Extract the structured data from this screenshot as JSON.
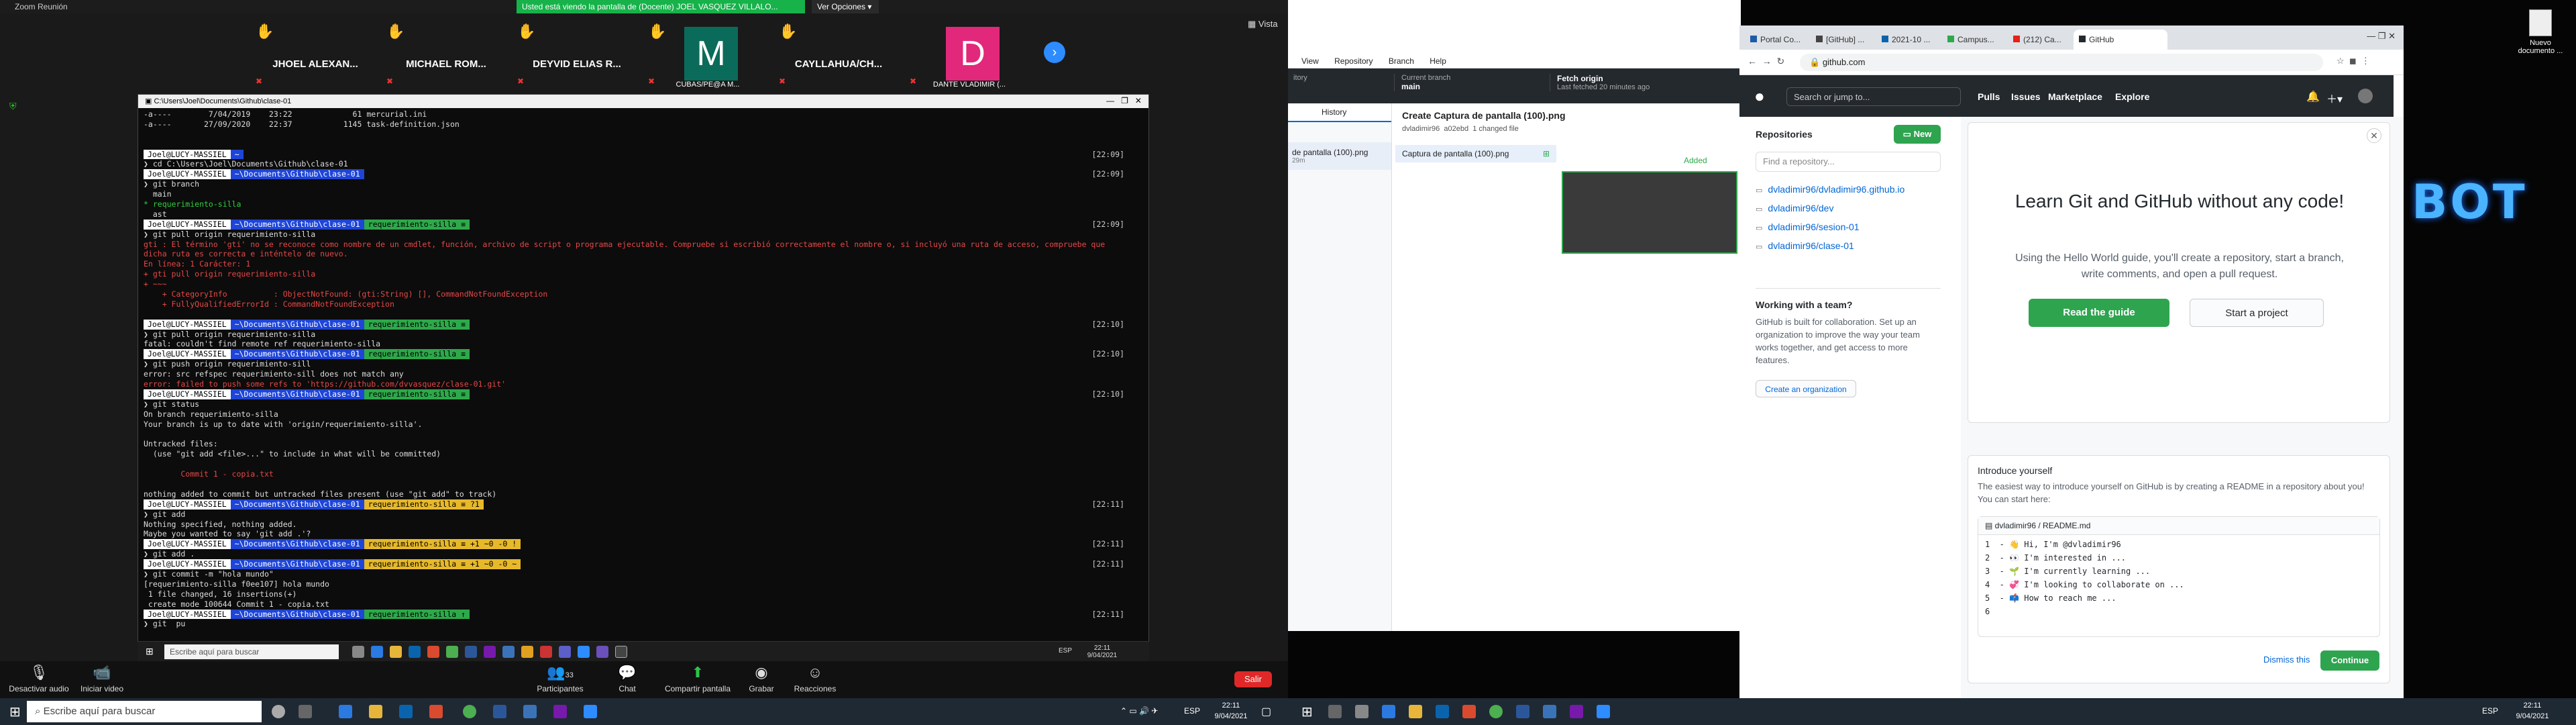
{
  "zoom": {
    "title": "Zoom Reunión",
    "banner": "Usted está viendo la pantalla de (Docente) JOEL VASQUEZ VILLALO...",
    "view_options": "Ver Opciones ▾",
    "vista": "Vista",
    "participants": [
      {
        "name": "JHOEL ALEXAN...",
        "hand": true,
        "avatar": "",
        "color": ""
      },
      {
        "name": "MICHAEL ROM...",
        "hand": true,
        "avatar": "",
        "color": ""
      },
      {
        "name": "DEYVID ELIAS R...",
        "hand": true,
        "avatar": "",
        "color": ""
      },
      {
        "name": "CUBAS/PE@A M...",
        "hand": true,
        "avatar": "M",
        "color": "#0b6b5a"
      },
      {
        "name": "CAYLLAHUA/CH...",
        "hand": true,
        "avatar": "",
        "color": ""
      },
      {
        "name": "DANTE VLADIMIR (...",
        "hand": false,
        "avatar": "D",
        "color": "#e2287a"
      }
    ],
    "controls": {
      "audio": "Desactivar audio",
      "video": "Iniciar video",
      "participants": "Participantes",
      "participants_count": "33",
      "chat": "Chat",
      "share": "Compartir pantalla",
      "record": "Grabar",
      "reactions": "Reacciones",
      "leave": "Salir"
    }
  },
  "terminal": {
    "title": "C:\\Users\\Joel\\Documents\\Github\\clase-01",
    "lines": [
      {
        "t": "-a----        7/04/2019    23:22             61 mercurial.ini",
        "c": "w"
      },
      {
        "t": "-a----       27/09/2020    22:37           1145 task-definition.json",
        "c": "w"
      },
      {
        "t": "",
        "c": "w"
      },
      {
        "t": "",
        "c": "w"
      },
      {
        "segs": [
          [
            "Joel@LUCY-MASSIEL",
            "s1"
          ],
          [
            "~",
            "s2"
          ]
        ],
        "ts": "[22:09]"
      },
      {
        "t": "❯ cd C:\\Users\\Joel\\Documents\\Github\\clase-01",
        "c": "w"
      },
      {
        "segs": [
          [
            "Joel@LUCY-MASSIEL",
            "s1"
          ],
          [
            "~\\Documents\\Github\\clase-01",
            "s2"
          ]
        ],
        "ts": "[22:09]"
      },
      {
        "t": "❯ git branch",
        "c": "w"
      },
      {
        "t": "  main",
        "c": "w"
      },
      {
        "t": "* requerimiento-silla",
        "c": "g"
      },
      {
        "t": "  ast",
        "c": "w"
      },
      {
        "segs": [
          [
            "Joel@LUCY-MASSIEL",
            "s1"
          ],
          [
            "~\\Documents\\Github\\clase-01",
            "s2"
          ],
          [
            "requerimiento-silla ≡",
            "s3"
          ]
        ],
        "ts": "[22:09]"
      },
      {
        "t": "❯ git pull origin requerimiento-silla",
        "c": "w"
      },
      {
        "t": "gti : El término 'gti' no se reconoce como nombre de un cmdlet, función, archivo de script o programa ejecutable. Compruebe si escribió correctamente el nombre o, si incluyó una ruta de acceso, compruebe que",
        "c": "r"
      },
      {
        "t": "dicha ruta es correcta e inténtelo de nuevo.",
        "c": "r"
      },
      {
        "t": "En línea: 1 Carácter: 1",
        "c": "r"
      },
      {
        "t": "+ gti pull origin requerimiento-silla",
        "c": "r"
      },
      {
        "t": "+ ~~~",
        "c": "r"
      },
      {
        "t": "    + CategoryInfo          : ObjectNotFound: (gti:String) [], CommandNotFoundException",
        "c": "r"
      },
      {
        "t": "    + FullyQualifiedErrorId : CommandNotFoundException",
        "c": "r"
      },
      {
        "t": "",
        "c": "w"
      },
      {
        "segs": [
          [
            "Joel@LUCY-MASSIEL",
            "s1"
          ],
          [
            "~\\Documents\\Github\\clase-01",
            "s2"
          ],
          [
            "requerimiento-silla ≡",
            "s3"
          ]
        ],
        "ts": "[22:10]"
      },
      {
        "t": "❯ git pull origin requerimiento-silla",
        "c": "w"
      },
      {
        "t": "fatal: couldn't find remote ref requerimiento-silla",
        "c": "w"
      },
      {
        "segs": [
          [
            "Joel@LUCY-MASSIEL",
            "s1"
          ],
          [
            "~\\Documents\\Github\\clase-01",
            "s2"
          ],
          [
            "requerimiento-silla ≡",
            "s3"
          ]
        ],
        "ts": "[22:10]"
      },
      {
        "t": "❯ git push origin requerimiento-sill",
        "c": "w"
      },
      {
        "t": "error: src refspec requerimiento-sill does not match any",
        "c": "w"
      },
      {
        "t": "error: failed to push some refs to 'https://github.com/dvvasquez/clase-01.git'",
        "c": "r"
      },
      {
        "segs": [
          [
            "Joel@LUCY-MASSIEL",
            "s1"
          ],
          [
            "~\\Documents\\Github\\clase-01",
            "s2"
          ],
          [
            "requerimiento-silla ≡",
            "s3"
          ]
        ],
        "ts": "[22:10]"
      },
      {
        "t": "❯ git status",
        "c": "w"
      },
      {
        "t": "On branch requerimiento-silla",
        "c": "w"
      },
      {
        "t": "Your branch is up to date with 'origin/requerimiento-silla'.",
        "c": "w"
      },
      {
        "t": "",
        "c": "w"
      },
      {
        "t": "Untracked files:",
        "c": "w"
      },
      {
        "t": "  (use \"git add <file>...\" to include in what will be committed)",
        "c": "w"
      },
      {
        "t": "",
        "c": "w"
      },
      {
        "t": "        Commit 1 - copia.txt",
        "c": "r"
      },
      {
        "t": "",
        "c": "w"
      },
      {
        "t": "nothing added to commit but untracked files present (use \"git add\" to track)",
        "c": "w"
      },
      {
        "segs": [
          [
            "Joel@LUCY-MASSIEL",
            "s1"
          ],
          [
            "~\\Documents\\Github\\clase-01",
            "s2"
          ],
          [
            "requerimiento-silla ≡ ?1",
            "s4"
          ]
        ],
        "ts": "[22:11]"
      },
      {
        "t": "❯ git add",
        "c": "w"
      },
      {
        "t": "Nothing specified, nothing added.",
        "c": "w"
      },
      {
        "t": "Maybe you wanted to say 'git add .'?",
        "c": "w"
      },
      {
        "segs": [
          [
            "Joel@LUCY-MASSIEL",
            "s1"
          ],
          [
            "~\\Documents\\Github\\clase-01",
            "s2"
          ],
          [
            "requerimiento-silla ≡ +1 ~0 -0 !",
            "s4"
          ]
        ],
        "ts": "[22:11]"
      },
      {
        "t": "❯ git add .",
        "c": "w"
      },
      {
        "segs": [
          [
            "Joel@LUCY-MASSIEL",
            "s1"
          ],
          [
            "~\\Documents\\Github\\clase-01",
            "s2"
          ],
          [
            "requerimiento-silla ≡ +1 ~0 -0 ~",
            "s4"
          ]
        ],
        "ts": "[22:11]"
      },
      {
        "t": "❯ git commit -m \"hola mundo\"",
        "c": "w"
      },
      {
        "t": "[requerimiento-silla f0ee107] hola mundo",
        "c": "w"
      },
      {
        "t": " 1 file changed, 16 insertions(+)",
        "c": "w"
      },
      {
        "t": " create mode 100644 Commit 1 - copia.txt",
        "c": "w"
      },
      {
        "segs": [
          [
            "Joel@LUCY-MASSIEL",
            "s1"
          ],
          [
            "~\\Documents\\Github\\clase-01",
            "s2"
          ],
          [
            "requerimiento-silla ↑",
            "s3"
          ]
        ],
        "ts": "[22:11]"
      },
      {
        "t": "❯ git  pu",
        "c": "w"
      }
    ]
  },
  "inner_taskbar": {
    "search": "Escribe aquí para buscar",
    "time": "22:11",
    "date": "9/04/2021",
    "lang": "ESP"
  },
  "left_taskbar": {
    "search": "Escribe aquí para buscar",
    "time": "22:11",
    "date": "9/04/2021",
    "lang": "ESP"
  },
  "right_taskbar": {
    "time": "22:11",
    "date": "9/04/2021",
    "lang": "ESP"
  },
  "github_desktop": {
    "menu": [
      "View",
      "Repository",
      "Branch",
      "Help"
    ],
    "repo_label": "itory",
    "branch_label": "Current branch",
    "branch": "main",
    "fetch_label": "Fetch origin",
    "fetch_sub": "Last fetched 20 minutes ago",
    "history_tab": "History",
    "history_item": "de pantalla (100).png",
    "history_sub": "29m",
    "commit_title": "Create Captura de pantalla (100).png",
    "commit_author": "dvladimir96",
    "commit_sha": "a02ebd",
    "commit_changed": "1 changed file",
    "file": "Captura de pantalla (100).png",
    "added": "Added"
  },
  "chrome": {
    "tabs": [
      "Portal Co...",
      "[GitHub] ...",
      "2021-10 ...",
      "Campus...",
      "(212) Ca...",
      "GitHub"
    ],
    "url": "github.com",
    "gh_search": "Search or jump to...",
    "nav": [
      "Pulls",
      "Issues",
      "Marketplace",
      "Explore"
    ],
    "repos_title": "Repositories",
    "new_btn": "New",
    "find_repo": "Find a repository...",
    "repos": [
      "dvladimir96/dvladimir96.github.io",
      "dvladimir96/dev",
      "dvladimir96/sesion-01",
      "dvladimir96/clase-01"
    ],
    "team_title": "Working with a team?",
    "team_text": "GitHub is built for collaboration. Set up an organization to improve the way your team works together, and get access to more features.",
    "create_org": "Create an organization",
    "learn_title": "Learn Git and GitHub without any code!",
    "learn_text": "Using the Hello World guide, you'll create a repository, start a branch, write comments, and open a pull request.",
    "read_guide": "Read the guide",
    "start_project": "Start a project",
    "intro_title": "Introduce yourself",
    "intro_text": "The easiest way to introduce yourself on GitHub is by creating a README in a repository about you! You can start here:",
    "readme_path": "dvladimir96 / README.md",
    "readme_lines": [
      "1  - 👋 Hi, I'm @dvladimir96",
      "2  - 👀 I'm interested in ...",
      "3  - 🌱 I'm currently learning ...",
      "4  - 💞️ I'm looking to collaborate on ...",
      "5  - 📫 How to reach me ...",
      "6"
    ],
    "dismiss": "Dismiss this",
    "continue": "Continue"
  },
  "desktop": {
    "icon_label": "Nuevo documento ...",
    "wallpaper_text": "BOT"
  }
}
